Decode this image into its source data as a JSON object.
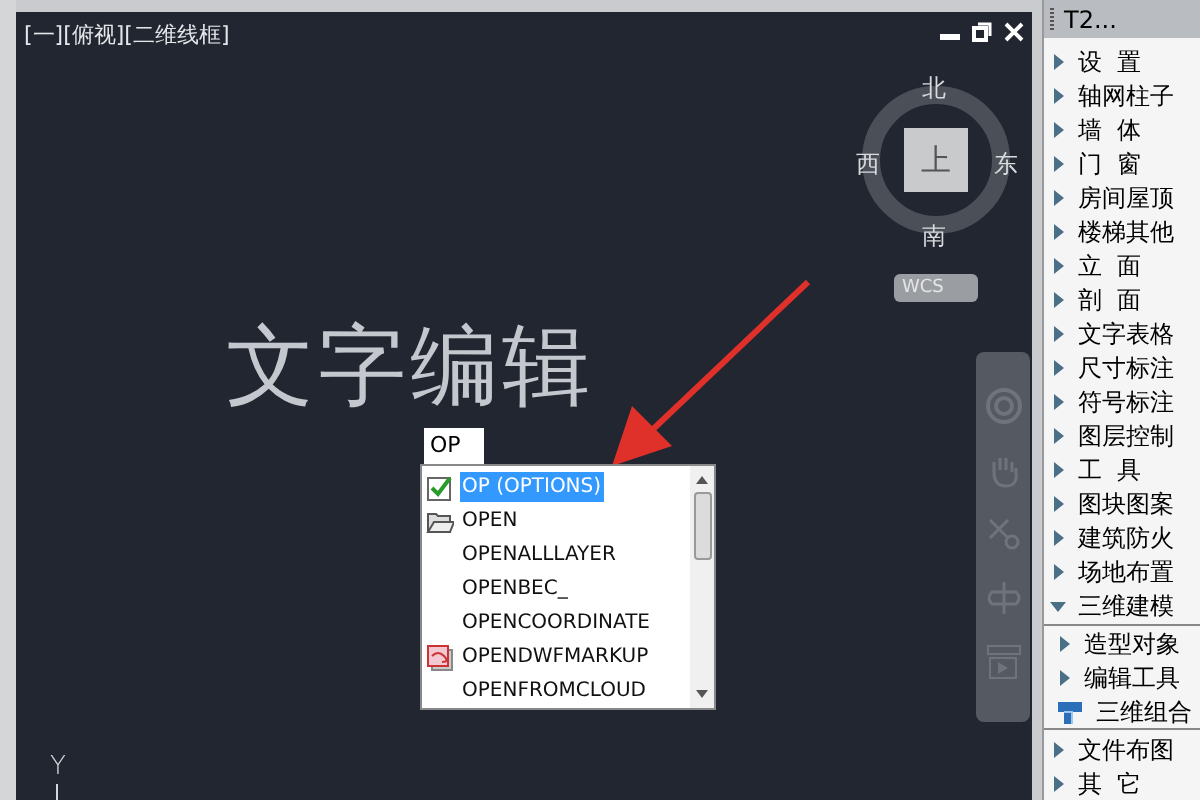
{
  "viewport": {
    "label": "[一][俯视][二维线框]"
  },
  "viewcube": {
    "north": "北",
    "south": "南",
    "west": "西",
    "east": "东",
    "face": "上",
    "wcs": "WCS"
  },
  "canvas": {
    "text": "文字编辑",
    "axis": "Y"
  },
  "command_input": {
    "value": "OP"
  },
  "autocomplete": [
    {
      "label": "OP (OPTIONS)",
      "kind": "option",
      "selected": true
    },
    {
      "label": "OPEN",
      "kind": "file",
      "selected": false
    },
    {
      "label": "OPENALLLAYER",
      "kind": "plain",
      "selected": false
    },
    {
      "label": "OPENBEC_",
      "kind": "plain",
      "selected": false
    },
    {
      "label": "OPENCOORDINATE",
      "kind": "plain",
      "selected": false
    },
    {
      "label": "OPENDWFMARKUP",
      "kind": "markup",
      "selected": false
    },
    {
      "label": "OPENFROMCLOUD",
      "kind": "plain",
      "selected": false
    }
  ],
  "tool_panel": {
    "title": "T2...",
    "items": [
      {
        "label": "设  置",
        "kind": "group",
        "expanded": false
      },
      {
        "label": "轴网柱子",
        "kind": "group",
        "expanded": false
      },
      {
        "label": "墙  体",
        "kind": "group",
        "expanded": false
      },
      {
        "label": "门  窗",
        "kind": "group",
        "expanded": false
      },
      {
        "label": "房间屋顶",
        "kind": "group",
        "expanded": false
      },
      {
        "label": "楼梯其他",
        "kind": "group",
        "expanded": false
      },
      {
        "label": "立  面",
        "kind": "group",
        "expanded": false
      },
      {
        "label": "剖  面",
        "kind": "group",
        "expanded": false
      },
      {
        "label": "文字表格",
        "kind": "group",
        "expanded": false
      },
      {
        "label": "尺寸标注",
        "kind": "group",
        "expanded": false
      },
      {
        "label": "符号标注",
        "kind": "group",
        "expanded": false
      },
      {
        "label": "图层控制",
        "kind": "group",
        "expanded": false
      },
      {
        "label": "工  具",
        "kind": "group",
        "expanded": false
      },
      {
        "label": "图块图案",
        "kind": "group",
        "expanded": false
      },
      {
        "label": "建筑防火",
        "kind": "group",
        "expanded": false
      },
      {
        "label": "场地布置",
        "kind": "group",
        "expanded": false
      },
      {
        "label": "三维建模",
        "kind": "group",
        "expanded": true,
        "children": [
          {
            "label": "造型对象",
            "kind": "group",
            "expanded": false
          },
          {
            "label": "编辑工具",
            "kind": "group",
            "expanded": false
          },
          {
            "label": "三维组合",
            "kind": "command"
          }
        ]
      },
      {
        "label": "文件布图",
        "kind": "group",
        "expanded": false
      },
      {
        "label": "其  它",
        "kind": "group",
        "expanded": false
      }
    ]
  }
}
